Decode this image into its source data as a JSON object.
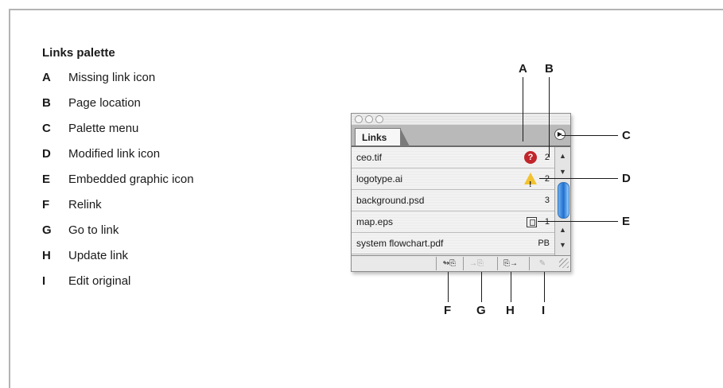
{
  "legend": {
    "title": "Links palette",
    "items": [
      {
        "letter": "A",
        "text": "Missing link icon"
      },
      {
        "letter": "B",
        "text": "Page location"
      },
      {
        "letter": "C",
        "text": "Palette menu"
      },
      {
        "letter": "D",
        "text": "Modified link icon"
      },
      {
        "letter": "E",
        "text": "Embedded graphic icon"
      },
      {
        "letter": "F",
        "text": "Relink"
      },
      {
        "letter": "G",
        "text": "Go to link"
      },
      {
        "letter": "H",
        "text": "Update link"
      },
      {
        "letter": "I",
        "text": "Edit original"
      }
    ]
  },
  "callouts": {
    "A": "A",
    "B": "B",
    "C": "C",
    "D": "D",
    "E": "E",
    "F": "F",
    "G": "G",
    "H": "H",
    "I": "I"
  },
  "palette": {
    "tab_label": "Links",
    "menu_icon": "triangle-right-icon",
    "rows": [
      {
        "name": "ceo.tif",
        "status": "missing",
        "page": "2"
      },
      {
        "name": "logotype.ai",
        "status": "modified",
        "page": "2"
      },
      {
        "name": "background.psd",
        "status": "",
        "page": "3"
      },
      {
        "name": "map.eps",
        "status": "embedded",
        "page": "1"
      },
      {
        "name": "system flowchart.pdf",
        "status": "",
        "page": "PB"
      }
    ],
    "buttons": {
      "relink": "↬⎘",
      "goto": "→⎘",
      "update": "⎘→",
      "edit": "✎"
    }
  }
}
